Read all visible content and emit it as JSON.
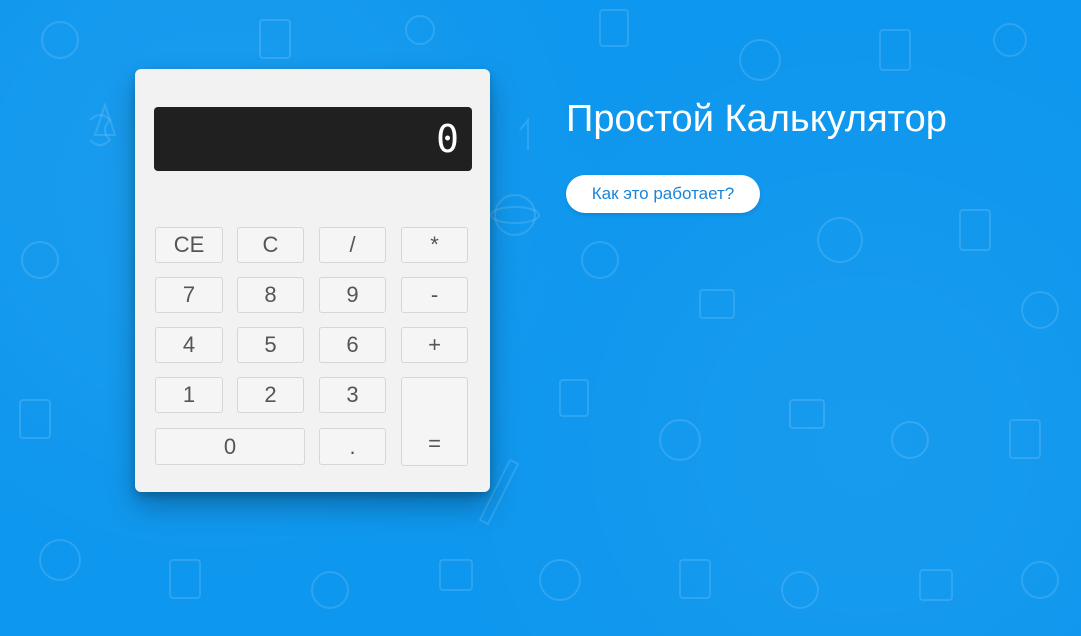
{
  "app": {
    "title": "Простой Калькулятор",
    "how_it_works_label": "Как это работает?"
  },
  "display": {
    "value": "0"
  },
  "keys": {
    "ce": "CE",
    "c": "C",
    "divide": "/",
    "multiply": "*",
    "seven": "7",
    "eight": "8",
    "nine": "9",
    "minus": "-",
    "four": "4",
    "five": "5",
    "six": "6",
    "plus": "+",
    "one": "1",
    "two": "2",
    "three": "3",
    "equals": "=",
    "zero": "0",
    "decimal": "."
  },
  "colors": {
    "background": "#0e97ee",
    "calculator_body": "#f2f2f2",
    "display_bg": "#202020",
    "button_text": "#1a84d8"
  }
}
